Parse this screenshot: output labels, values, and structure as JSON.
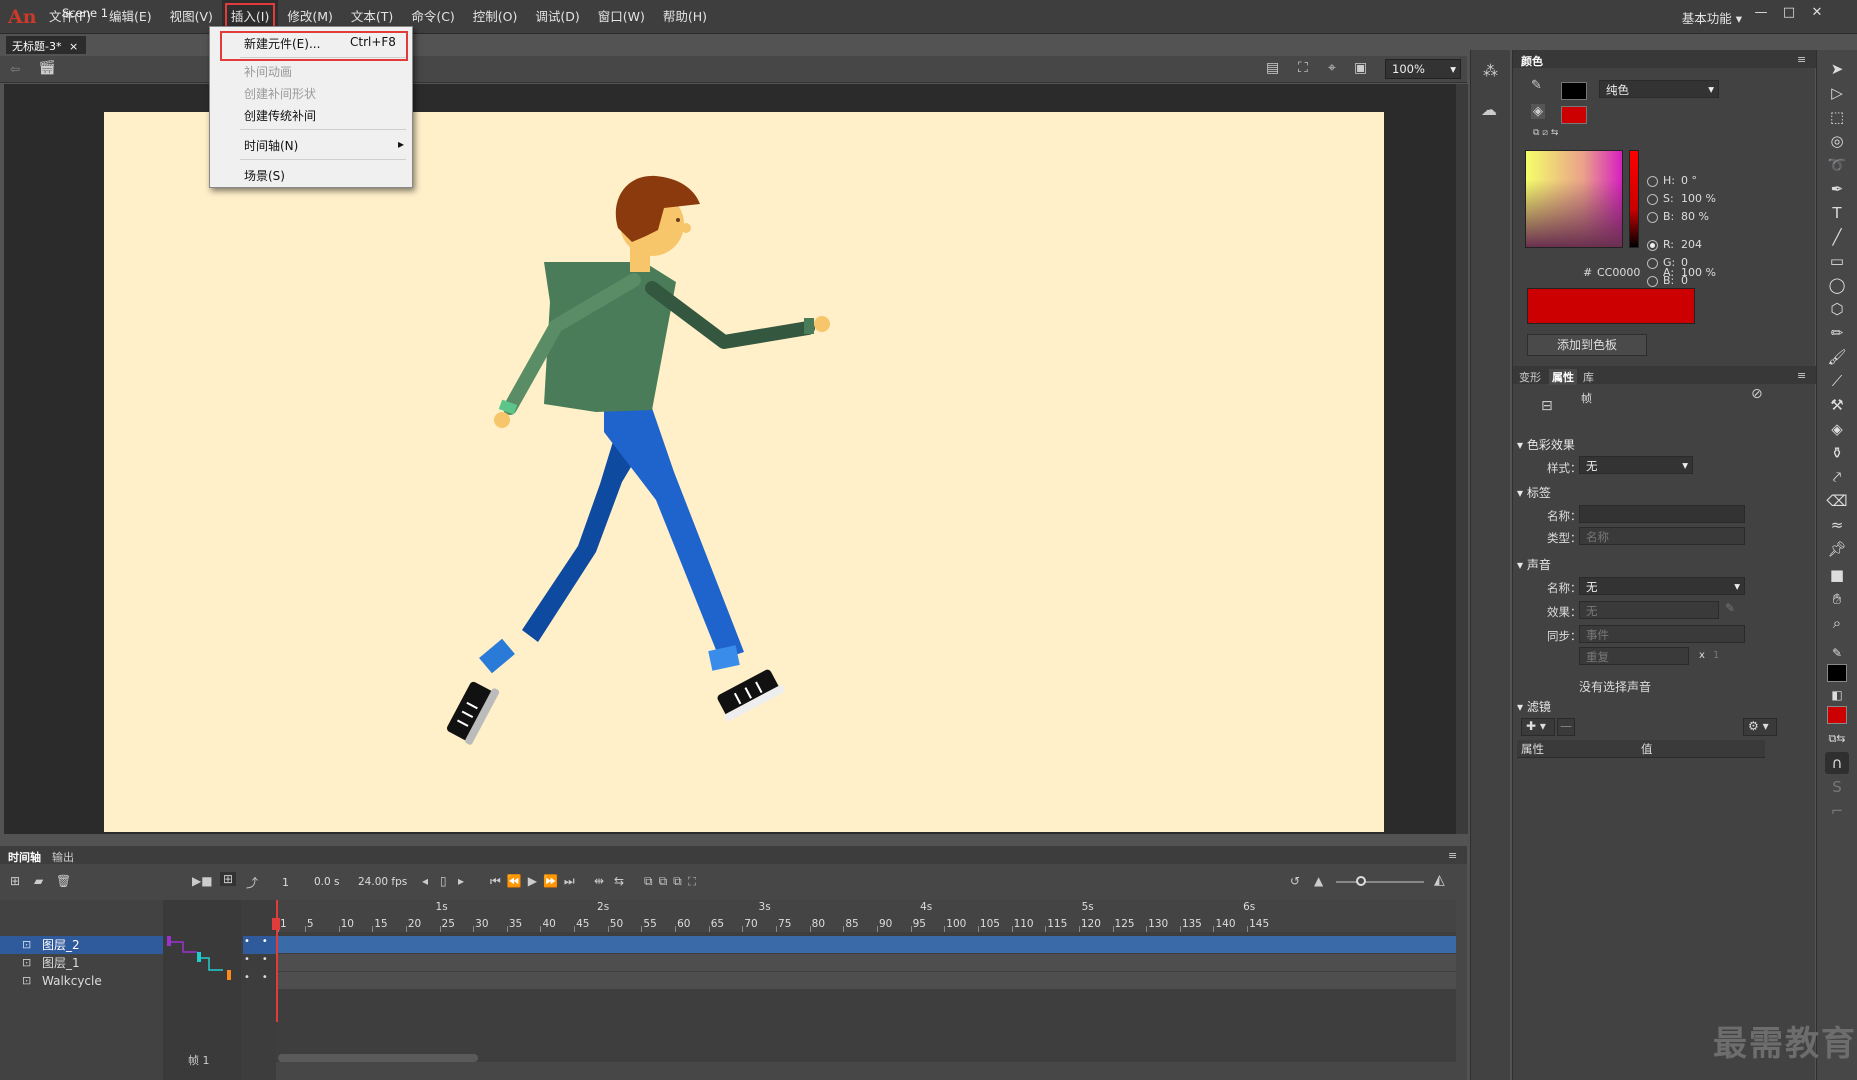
{
  "app": {
    "logo": "An"
  },
  "menubar": {
    "items": [
      "文件(F)",
      "编辑(E)",
      "视图(V)",
      "插入(I)",
      "修改(M)",
      "文本(T)",
      "命令(C)",
      "控制(O)",
      "调试(D)",
      "窗口(W)",
      "帮助(H)"
    ],
    "active": "插入(I)",
    "workspace": "基本功能"
  },
  "document": {
    "tab": "无标题-3*",
    "scene": "Scene 1",
    "zoom": "100%"
  },
  "insert_menu": {
    "new_symbol": "新建元件(E)...",
    "new_symbol_shortcut": "Ctrl+F8",
    "motion_tween": "补间动画",
    "shape_tween": "创建补间形状",
    "classic_tween": "创建传统补间",
    "timeline": "时间轴(N)",
    "scene": "场景(S)"
  },
  "color_panel": {
    "tab": "颜色",
    "type": "纯色",
    "H_label": "H:",
    "H": "0 °",
    "S_label": "S:",
    "S": "100 %",
    "B_label": "B:",
    "B": "80 %",
    "R_label": "R:",
    "R": "204",
    "G_label": "G:",
    "G": "0",
    "Bl_label": "B:",
    "Bl": "0",
    "hex_label": "#",
    "hex": "CC0000",
    "A_label": "A:",
    "A": "100 %",
    "add_swatch": "添加到色板",
    "stroke_color": "#000000",
    "fill_color": "#cc0000"
  },
  "props_panel": {
    "tabs": [
      "变形",
      "属性",
      "库"
    ],
    "active_tab": "属性",
    "frame_label": "帧",
    "color_effect": "色彩效果",
    "style_label": "样式：",
    "style_value": "无",
    "label_section": "标签",
    "name_label": "名称：",
    "type_label": "类型：",
    "type_value": "名称",
    "sound_section": "声音",
    "sound_name_label": "名称：",
    "sound_name_value": "无",
    "effect_label": "效果：",
    "effect_value": "无",
    "sync_label": "同步：",
    "sync_value": "事件",
    "repeat_value": "重复",
    "repeat_x": "x",
    "repeat_count": "1",
    "no_sound": "没有选择声音",
    "filter_section": "滤镜",
    "filter_col1": "属性",
    "filter_col2": "值"
  },
  "timeline": {
    "tabs": [
      "时间轴",
      "输出"
    ],
    "frame": "1",
    "time": "0.0 s",
    "fps": "24.00 fps",
    "layers": [
      {
        "name": "图层_2",
        "selected": true
      },
      {
        "name": "图层_1",
        "selected": false
      },
      {
        "name": "Walkcycle",
        "selected": false
      }
    ],
    "frame_numbers": [
      "1",
      "5",
      "10",
      "15",
      "20",
      "25",
      "30",
      "35",
      "40",
      "45",
      "50",
      "55",
      "60",
      "65",
      "70",
      "75",
      "80",
      "85",
      "90",
      "95",
      "100",
      "105",
      "110",
      "115",
      "120",
      "125",
      "130",
      "135",
      "140",
      "145"
    ],
    "seconds": [
      "1s",
      "2s",
      "3s",
      "4s",
      "5s",
      "6s"
    ],
    "footer_frame_label": "帧",
    "footer_frame": "1"
  },
  "watermark": "最需教育"
}
